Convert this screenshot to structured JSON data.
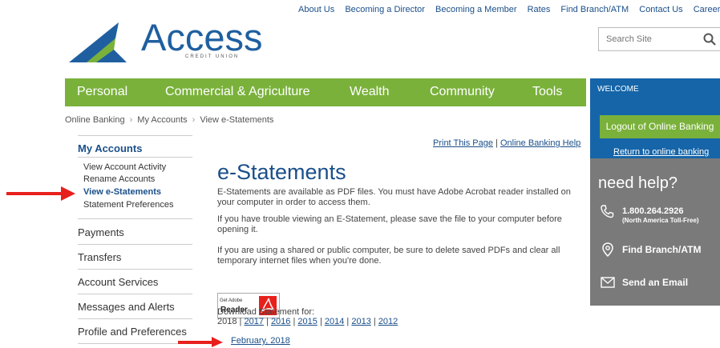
{
  "top_links": [
    "About Us",
    "Becoming a Director",
    "Becoming a Member",
    "Rates",
    "Find Branch/ATM",
    "Contact Us",
    "Careers"
  ],
  "logo": {
    "word": "Access",
    "sub": "CREDIT UNION"
  },
  "search": {
    "placeholder": "Search Site"
  },
  "nav": [
    "Personal",
    "Commercial & Agriculture",
    "Wealth",
    "Community",
    "Tools"
  ],
  "welcome": {
    "title": "WELCOME",
    "logout": "Logout of Online Banking",
    "return": "Return to online banking"
  },
  "help": {
    "title": "need help?",
    "phone": "1.800.264.2926",
    "phone_sub": "(North America Toll-Free)",
    "branch": "Find Branch/ATM",
    "email": "Send an Email"
  },
  "breadcrumb": [
    "Online Banking",
    "My Accounts",
    "View e-Statements"
  ],
  "sidebar": {
    "heading": "My Accounts",
    "subitems": [
      "View Account Activity",
      "Rename Accounts",
      "View e-Statements",
      "Statement Preferences"
    ],
    "categories": [
      "Payments",
      "Transfers",
      "Account Services",
      "Messages and Alerts",
      "Profile and Preferences"
    ]
  },
  "main": {
    "print": "Print This Page",
    "sep": " | ",
    "help": "Online Banking Help",
    "title": "e-Statements",
    "paragraphs": [
      "E-Statements are available as PDF files. You must have Adobe Acrobat reader installed on your computer in order to access them.",
      "If you have trouble viewing an E-Statement, please save the file to your computer before opening it.",
      "If you are using a shared or public computer, be sure to delete saved PDFs and clear all temporary internet files when you're done."
    ],
    "adobe_small": "Get Adobe",
    "adobe_big": "Reader",
    "download_label": "Download Statement for:",
    "current_year": "2018",
    "years": [
      "2017",
      "2016",
      "2015",
      "2014",
      "2013",
      "2012"
    ],
    "month": "February, 2018"
  },
  "colors": {
    "nav_green": "#7ab13b",
    "welcome_blue": "#1565a8",
    "help_gray": "#7a7a7a",
    "arrow_red": "#e8201c"
  }
}
